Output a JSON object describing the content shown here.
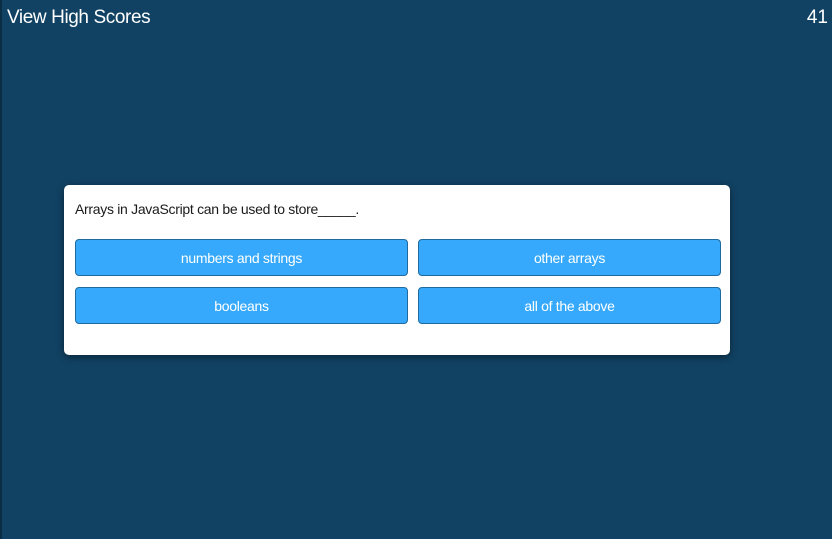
{
  "header": {
    "high_scores_label": "View High Scores",
    "timer": "41"
  },
  "quiz": {
    "question": "Arrays in JavaScript can be used to store_____.",
    "answers": [
      "numbers and strings",
      "other arrays",
      "booleans",
      "all of the above"
    ]
  },
  "colors": {
    "background": "#114263",
    "card": "#ffffff",
    "answer_button": "#36a9fc"
  }
}
